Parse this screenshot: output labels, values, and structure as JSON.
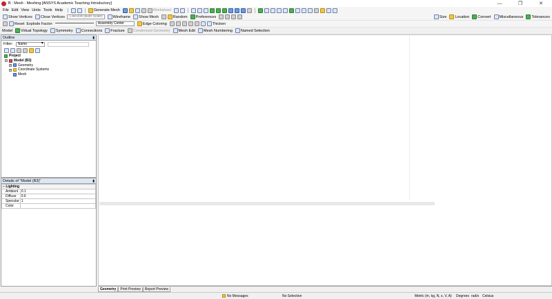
{
  "window": {
    "title": "B : Mesh - Meshing [ANSYS Academic Teaching Introductory]",
    "controls": [
      "—",
      "❐",
      "✕"
    ]
  },
  "menu": [
    "File",
    "Edit",
    "View",
    "Units",
    "Tools",
    "Help"
  ],
  "toolbar_main": {
    "generate_mesh": "Generate Mesh",
    "worksheet": "Worksheet"
  },
  "toolbar_right": {
    "size": "Size",
    "location": "Location",
    "convert": "Convert",
    "miscellaneous": "Miscellaneous",
    "tolerances": "Tolerances"
  },
  "toolbar_display": {
    "show_vertices": "Show Vertices",
    "close_vertices": "Close Vertices",
    "auto_scale": "1.4e-004 (Auto Scale)",
    "wireframe": "Wireframe",
    "show_mesh": "Show Mesh",
    "random": "Random",
    "preferences": "Preferences"
  },
  "toolbar_explode": {
    "reset": "Reset",
    "explode_factor": "Explode Factor:",
    "assembly_center": "Assembly Center",
    "edge_coloring": "Edge Coloring",
    "thicken": "Thicken"
  },
  "context_toolbar": {
    "model": "Model",
    "virtual_topology": "Virtual Topology",
    "symmetry": "Symmetry",
    "connections": "Connections",
    "fracture": "Fracture",
    "condensed_geometry": "Condensed Geometry",
    "mesh_edit": "Mesh Edit",
    "mesh_numbering": "Mesh Numbering",
    "named_selection": "Named Selection"
  },
  "outline": {
    "title": "Outline",
    "filter_label": "Filter:",
    "filter_value": "Name",
    "tree": [
      {
        "label": "Project",
        "bold": true
      },
      {
        "label": "Model (B3)",
        "bold": true
      },
      {
        "label": "Geometry",
        "bold": false
      },
      {
        "label": "Coordinate Systems",
        "bold": false
      },
      {
        "label": "Mesh",
        "bold": false
      }
    ]
  },
  "details": {
    "title": "Details of \"Model (B3)\"",
    "group": "Lighting",
    "rows": [
      {
        "k": "Ambient",
        "v": "0.1"
      },
      {
        "k": "Diffuse",
        "v": "0.6"
      },
      {
        "k": "Specular",
        "v": "1"
      },
      {
        "k": "Color",
        "v": ""
      }
    ]
  },
  "tabs": [
    "Geometry",
    "Print Preview",
    "Report Preview"
  ],
  "status": {
    "messages": "No Messages",
    "selection": "No Selection",
    "units": "Metric (m, kg, N, s, V, A)",
    "angle": "Degrees",
    "rate": "rad/s",
    "temperature": "Celsius"
  }
}
